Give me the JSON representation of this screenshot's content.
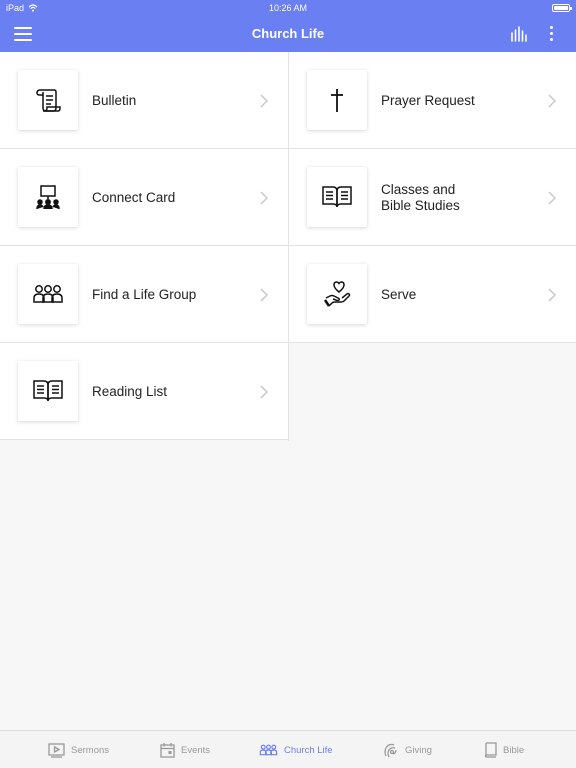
{
  "status": {
    "device": "iPad",
    "time": "10:26 AM"
  },
  "nav": {
    "title": "Church Life"
  },
  "colors": {
    "accent": "#6a7ff2",
    "inactive": "#999999"
  },
  "items": [
    {
      "label": "Bulletin",
      "icon": "scroll-icon"
    },
    {
      "label": "Prayer Request",
      "icon": "cross-icon"
    },
    {
      "label": "Connect Card",
      "icon": "presenter-icon"
    },
    {
      "label": "Classes and Bible Studies",
      "label_line1": "Classes and",
      "label_line2": "Bible Studies",
      "icon": "open-book-icon"
    },
    {
      "label": "Find a Life Group",
      "icon": "group-icon"
    },
    {
      "label": "Serve",
      "icon": "heart-hand-icon"
    },
    {
      "label": "Reading List",
      "icon": "open-book-icon"
    }
  ],
  "tabs": [
    {
      "label": "Sermons",
      "icon": "video-icon",
      "active": false
    },
    {
      "label": "Events",
      "icon": "calendar-icon",
      "active": false
    },
    {
      "label": "Church Life",
      "icon": "group-icon",
      "active": true
    },
    {
      "label": "Giving",
      "icon": "giving-icon",
      "active": false
    },
    {
      "label": "Bible",
      "icon": "book-icon",
      "active": false
    }
  ]
}
